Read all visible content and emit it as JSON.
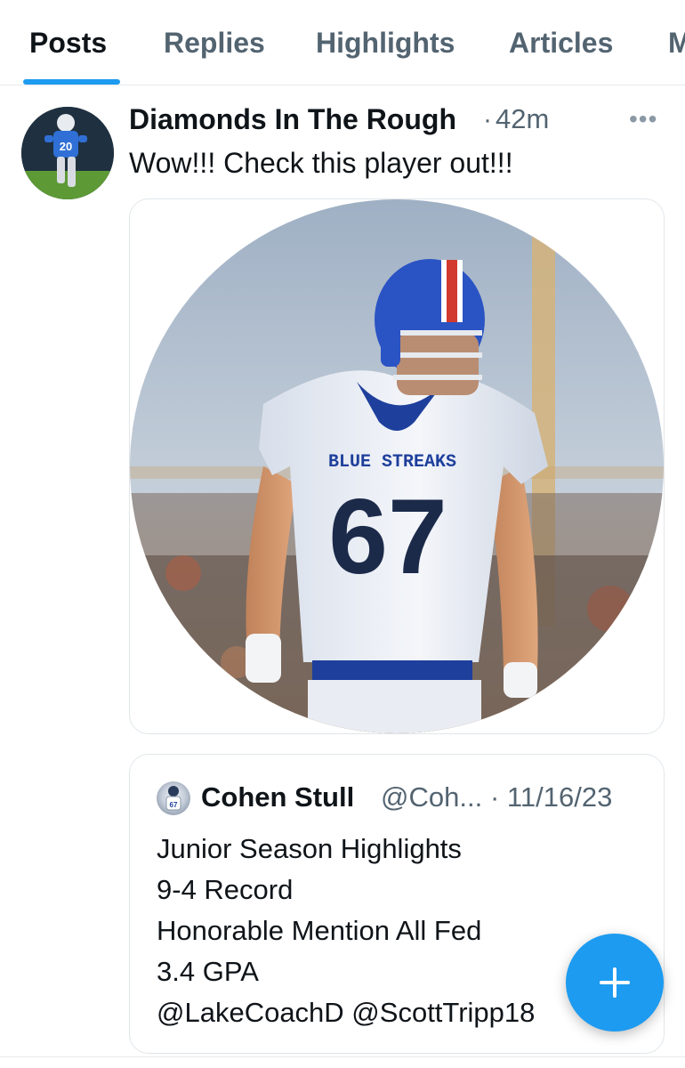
{
  "tabs": [
    "Posts",
    "Replies",
    "Highlights",
    "Articles",
    "M"
  ],
  "active_tab": "Posts",
  "post": {
    "author": "Diamonds In The Rough",
    "separator": "·",
    "time": "42m",
    "more": "•••",
    "text": "Wow!!! Check this player out!!!",
    "media": {
      "jersey_text": "BLUE STREAKS",
      "jersey_number": "67"
    }
  },
  "quote": {
    "name": "Cohen Stull",
    "handle": "@Coh...",
    "date": "· 11/16/23",
    "lines": [
      "Junior Season Highlights",
      "9-4 Record",
      "Honorable Mention All Fed",
      "3.4 GPA",
      "@LakeCoachD @ScottTripp18"
    ]
  },
  "fab": {
    "icon": "plus-icon"
  },
  "colors": {
    "accent": "#1d9bf0",
    "text_primary": "#0f1419",
    "text_secondary": "#536471",
    "border": "#e1e6ea",
    "jersey_blue": "#1e3f9c"
  }
}
